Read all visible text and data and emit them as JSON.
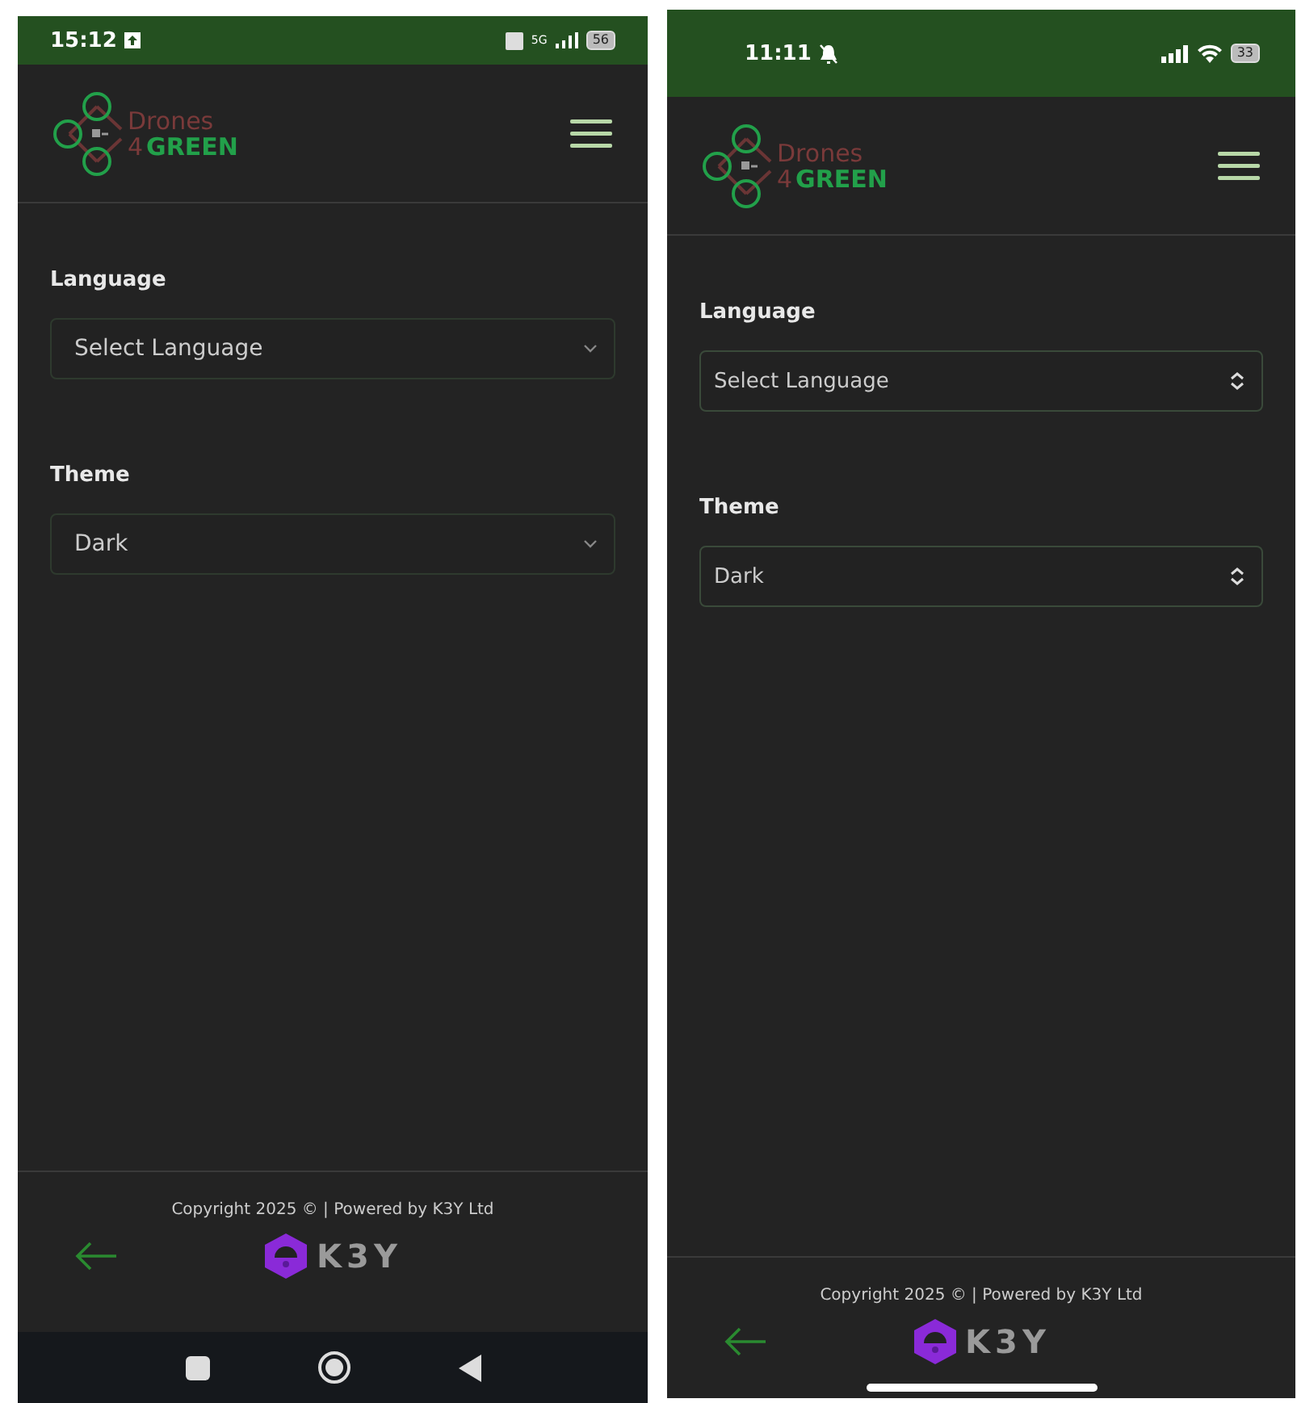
{
  "screens": [
    {
      "kind": "android",
      "status_bar": {
        "time": "15:12",
        "network": "5G",
        "battery": "56"
      },
      "logo": {
        "word": "Drones",
        "digit": "4",
        "name": "GREEN"
      },
      "fields": [
        {
          "label": "Language",
          "value": "Select Language"
        },
        {
          "label": "Theme",
          "value": "Dark"
        }
      ],
      "footer": {
        "copyright": "Copyright 2025 © | Powered by K3Y Ltd",
        "brand": "K3Y"
      }
    },
    {
      "kind": "ios",
      "status_bar": {
        "time": "11:11",
        "battery": "33"
      },
      "logo": {
        "word": "Drones",
        "digit": "4",
        "name": "GREEN"
      },
      "fields": [
        {
          "label": "Language",
          "value": "Select Language"
        },
        {
          "label": "Theme",
          "value": "Dark"
        }
      ],
      "footer": {
        "copyright": "Copyright 2025 © | Powered by K3Y Ltd",
        "brand": "K3Y"
      }
    }
  ]
}
